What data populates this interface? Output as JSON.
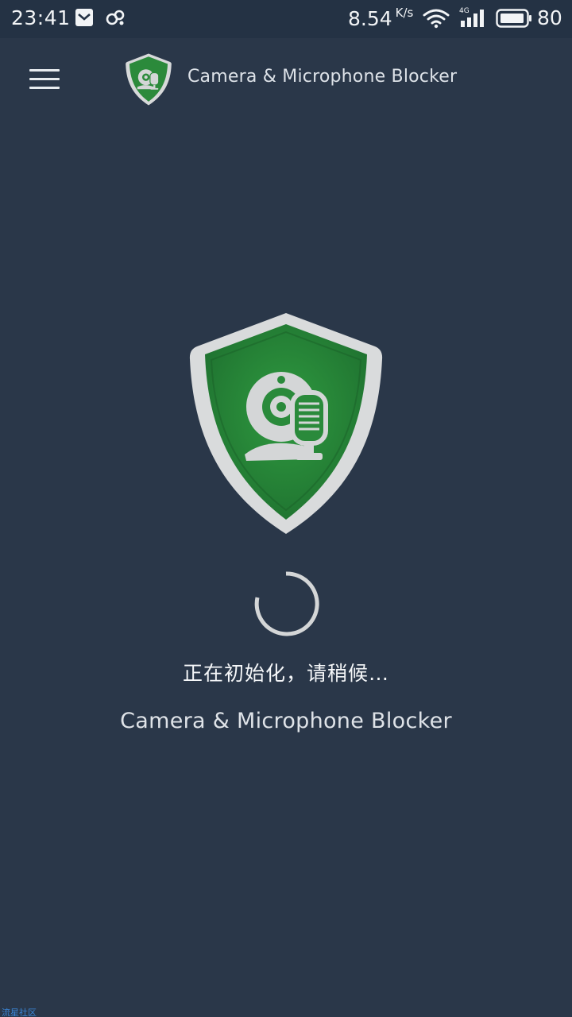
{
  "status_bar": {
    "time": "23:41",
    "notification_icons": [
      "mail-box-icon",
      "cloud-link-icon"
    ],
    "net_speed": "8.54",
    "net_speed_unit": "K/s",
    "network_type": "4G",
    "battery_percent": "80",
    "icons": [
      "wifi-icon",
      "signal-icon",
      "battery-icon"
    ]
  },
  "app_bar": {
    "menu_icon": "hamburger-menu-icon",
    "logo_icon": "shield-camera-mic-icon",
    "title": "Camera & Microphone Blocker"
  },
  "main": {
    "logo_icon": "shield-camera-mic-icon",
    "spinner_icon": "loading-spinner",
    "loading_text": "正在初始化，请稍候…",
    "subtitle": "Camera & Microphone Blocker"
  },
  "watermark": "流星社区",
  "colors": {
    "background": "#2a3749",
    "status_bar": "#243244",
    "shield_green": "#2a8a3a",
    "shield_rim": "#d9dbdc",
    "text": "#f5f7f9"
  }
}
